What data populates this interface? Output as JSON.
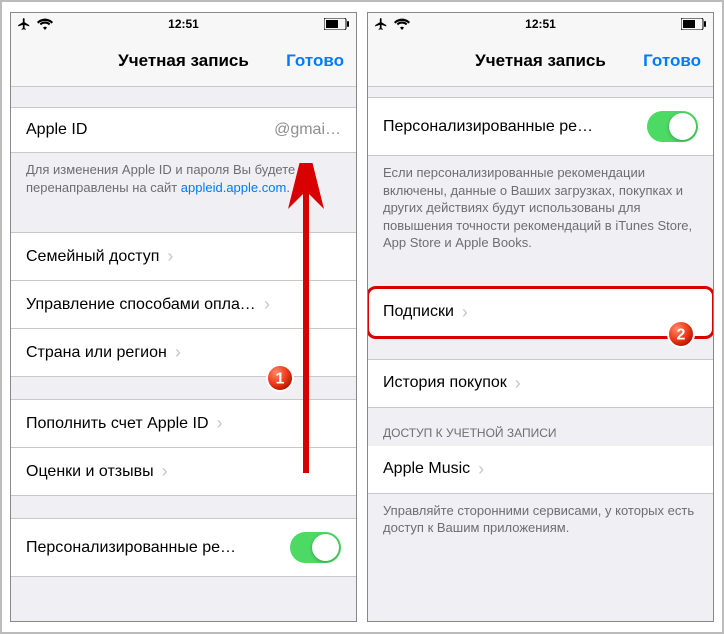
{
  "statusbar": {
    "time": "12:51"
  },
  "nav": {
    "title": "Учетная запись",
    "done": "Готово"
  },
  "left": {
    "apple_id_label": "Apple ID",
    "apple_id_value": "@gmai…",
    "footer1_a": "Для изменения Apple ID и пароля Вы будете перенаправлены на сайт ",
    "footer1_link": "appleid.apple.com",
    "family": "Семейный доступ",
    "payment": "Управление способами оплаты",
    "region": "Страна или регион",
    "topup": "Пополнить счет Apple ID",
    "reviews": "Оценки и отзывы",
    "personalized": "Персонализированные ре…"
  },
  "right": {
    "personalized": "Персонализированные ре…",
    "personalized_footer": "Если персонализированные рекомендации включены, данные о Ваших загрузках, покупках и других действиях будут использованы для повышения точности рекомендаций в iTunes Store, App Store и Apple Books.",
    "subs": "Подписки",
    "history": "История покупок",
    "access_header": "ДОСТУП К УЧЕТНОЙ ЗАПИСИ",
    "apple_music": "Apple Music",
    "access_footer": "Управляйте сторонними сервисами, у которых есть доступ к Вашим приложениям."
  },
  "badges": {
    "one": "1",
    "two": "2"
  }
}
